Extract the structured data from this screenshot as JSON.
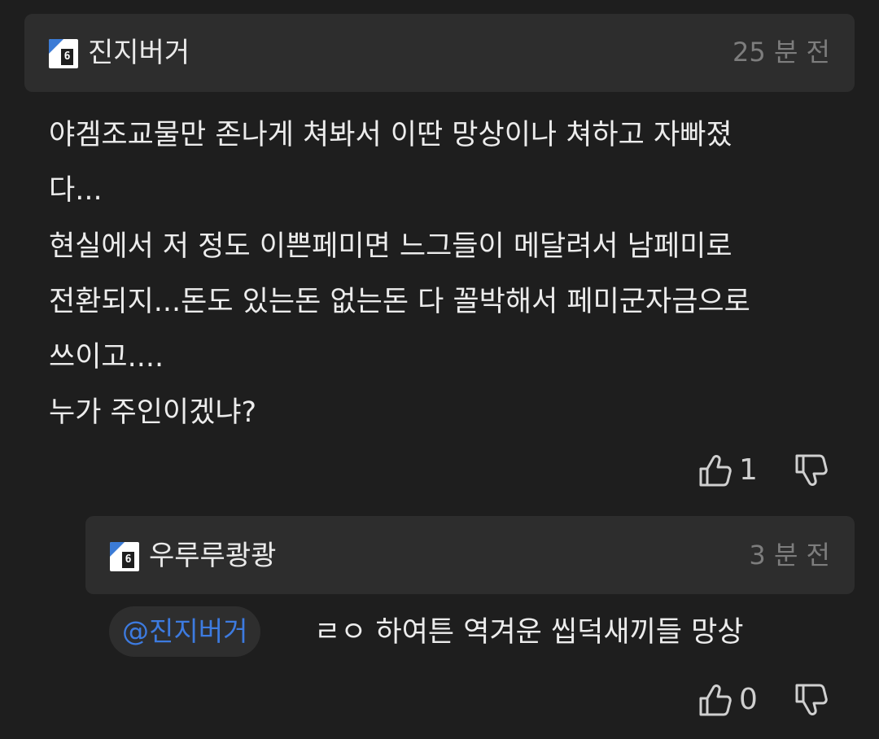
{
  "comment": {
    "username": "진지버거",
    "level": "6",
    "time": "25 분 전",
    "body_lines": [
      "야겜조교물만 존나게 쳐봐서 이딴 망상이나 쳐하고 자빠졌",
      "다...",
      "현실에서 저 정도 이쁜페미면 느그들이 메달려서 남페미로",
      "전환되지...돈도 있는돈 없는돈 다 꼴박해서 페미군자금으로",
      "쓰이고....",
      "누가 주인이겠냐?"
    ],
    "likes": "1"
  },
  "reply": {
    "username": "우루루쾅쾅",
    "level": "6",
    "time": "3 분 전",
    "mention": "@진지버거",
    "text": "ㄹㅇ 하여튼 역겨운 씹덕새끼들 망상",
    "likes": "0"
  },
  "icons": {
    "like": "thumbs-up-icon",
    "dislike": "thumbs-down-icon",
    "level_badge": "level-badge-icon"
  },
  "colors": {
    "background": "#1e1e1e",
    "header": "#2d2d2d",
    "mention": "#3d7be0",
    "muted": "#7d7d7d"
  }
}
